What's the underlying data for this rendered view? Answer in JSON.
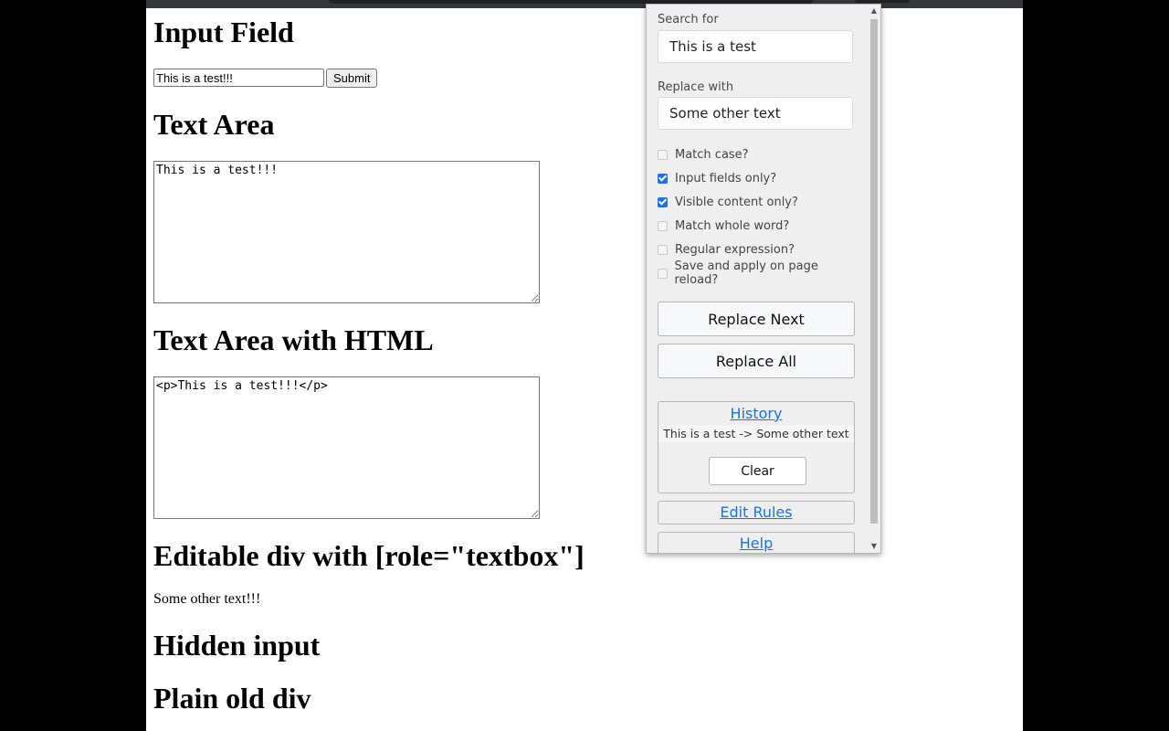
{
  "page": {
    "headings": {
      "input_field": "Input Field",
      "text_area": "Text Area",
      "text_area_html": "Text Area with HTML",
      "editable_div": "Editable div with [role=\"textbox\"]",
      "hidden_input": "Hidden input",
      "plain_div": "Plain old div"
    },
    "input_value": "This is a test!!!",
    "submit_label": "Submit",
    "textarea_value": "This is a test!!!",
    "textarea_html_value": "<p>This is a test!!!</p>",
    "editable_text": "Some other text!!!"
  },
  "popup": {
    "search_label": "Search for",
    "search_value": "This is a test",
    "replace_label": "Replace with",
    "replace_value": "Some other text",
    "options": [
      {
        "label": "Match case?",
        "checked": false
      },
      {
        "label": "Input fields only?",
        "checked": true
      },
      {
        "label": "Visible content only?",
        "checked": true
      },
      {
        "label": "Match whole word?",
        "checked": false
      },
      {
        "label": "Regular expression?",
        "checked": false
      },
      {
        "label": "Save and apply on page reload?",
        "checked": false
      }
    ],
    "replace_next_label": "Replace Next",
    "replace_all_label": "Replace All",
    "history_title": "History",
    "history_entry": "This is a test -> Some other text",
    "clear_label": "Clear",
    "edit_rules_label": "Edit Rules",
    "help_label": "Help"
  },
  "colors": {
    "accent": "#1a73e8",
    "popup_bg": "#efefef"
  }
}
